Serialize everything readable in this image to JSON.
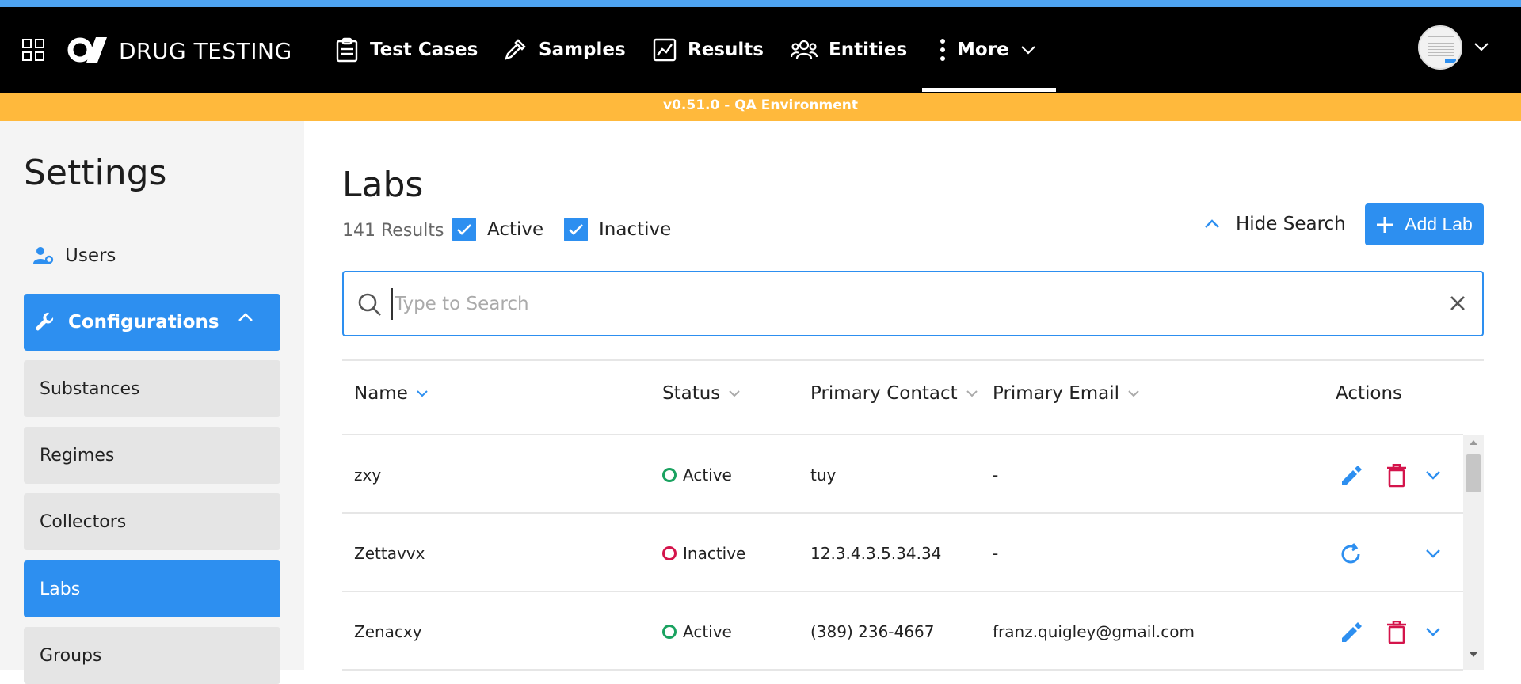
{
  "nav": {
    "brand": "DRUG TESTING",
    "items": [
      {
        "label": "Test Cases",
        "icon": "clipboard-icon"
      },
      {
        "label": "Samples",
        "icon": "pipette-icon"
      },
      {
        "label": "Results",
        "icon": "chart-icon"
      },
      {
        "label": "Entities",
        "icon": "people-icon"
      },
      {
        "label": "More",
        "icon": "kebab-icon"
      }
    ],
    "active_item": "More"
  },
  "env_banner": "v0.51.0 - QA Environment",
  "sidebar": {
    "title": "Settings",
    "users_label": "Users",
    "config_label": "Configurations",
    "sub_items": [
      {
        "label": "Substances",
        "active": false
      },
      {
        "label": "Regimes",
        "active": false
      },
      {
        "label": "Collectors",
        "active": false
      },
      {
        "label": "Labs",
        "active": true
      },
      {
        "label": "Groups",
        "active": false
      }
    ]
  },
  "page": {
    "title": "Labs",
    "results_count": "141 Results",
    "filter_active_label": "Active",
    "filter_inactive_label": "Inactive",
    "filter_active_checked": true,
    "filter_inactive_checked": true,
    "hide_search_label": "Hide Search",
    "add_button_label": "Add Lab",
    "search_placeholder": "Type to Search",
    "search_value": ""
  },
  "table": {
    "headers": {
      "name": "Name",
      "status": "Status",
      "contact": "Primary Contact",
      "email": "Primary Email",
      "actions": "Actions"
    },
    "rows": [
      {
        "name": "zxy",
        "status": "Active",
        "contact": "tuy",
        "email": "-"
      },
      {
        "name": "Zettavvx",
        "status": "Inactive",
        "contact": "12.3.4.3.5.34.34",
        "email": "-"
      },
      {
        "name": "Zenacxy",
        "status": "Active",
        "contact": "(389) 236-4667",
        "email": "franz.quigley@gmail.com"
      }
    ]
  },
  "colors": {
    "accent": "#2d8ff0",
    "banner": "#ffb93c",
    "active": "#1aa260",
    "inactive": "#d4144b",
    "delete": "#d4144b"
  }
}
